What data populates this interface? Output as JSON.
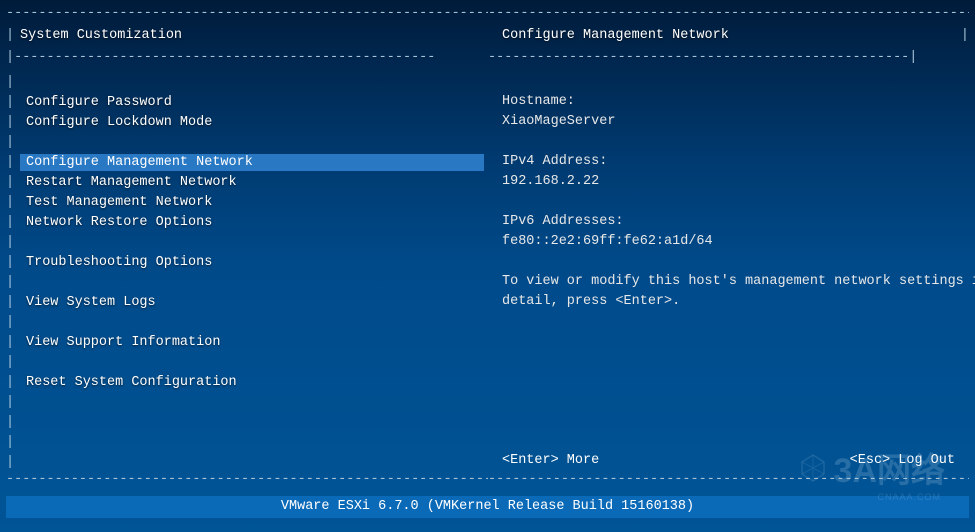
{
  "left": {
    "title": "System Customization",
    "items": [
      {
        "label": "",
        "blank": true
      },
      {
        "label": "Configure Password",
        "interact": true
      },
      {
        "label": "Configure Lockdown Mode",
        "interact": true
      },
      {
        "label": "",
        "blank": true
      },
      {
        "label": "Configure Management Network",
        "interact": true,
        "selected": true
      },
      {
        "label": "Restart Management Network",
        "interact": true
      },
      {
        "label": "Test Management Network",
        "interact": true
      },
      {
        "label": "Network Restore Options",
        "interact": true
      },
      {
        "label": "",
        "blank": true
      },
      {
        "label": "Troubleshooting Options",
        "interact": true
      },
      {
        "label": "",
        "blank": true
      },
      {
        "label": "View System Logs",
        "interact": true
      },
      {
        "label": "",
        "blank": true
      },
      {
        "label": "View Support Information",
        "interact": true
      },
      {
        "label": "",
        "blank": true
      },
      {
        "label": "Reset System Configuration",
        "interact": true
      },
      {
        "label": "",
        "blank": true
      },
      {
        "label": "",
        "blank": true
      },
      {
        "label": "",
        "blank": true
      },
      {
        "label": "",
        "blank": true
      }
    ]
  },
  "right": {
    "title": "Configure Management Network",
    "lines": [
      "",
      "Hostname:",
      "XiaoMageServer",
      "",
      "IPv4 Address:",
      "192.168.2.22",
      "",
      "IPv6 Addresses:",
      "fe80::2e2:69ff:fe62:a1d/64",
      "",
      "To view or modify this host's management network settings in",
      "detail, press <Enter>."
    ],
    "hint_left": "<Enter> More",
    "hint_right": "<Esc> Log Out"
  },
  "status": "VMware ESXi 6.7.0 (VMKernel Release Build 15160138)",
  "border": {
    "dash": "--------------------------------------------------------------------------------------------------------------",
    "hr_left": "|----------------------------------------------------",
    "hr_right": "----------------------------------------------------|"
  },
  "watermark": {
    "main": "3A网络",
    "sub": "CNAAA.COM"
  }
}
